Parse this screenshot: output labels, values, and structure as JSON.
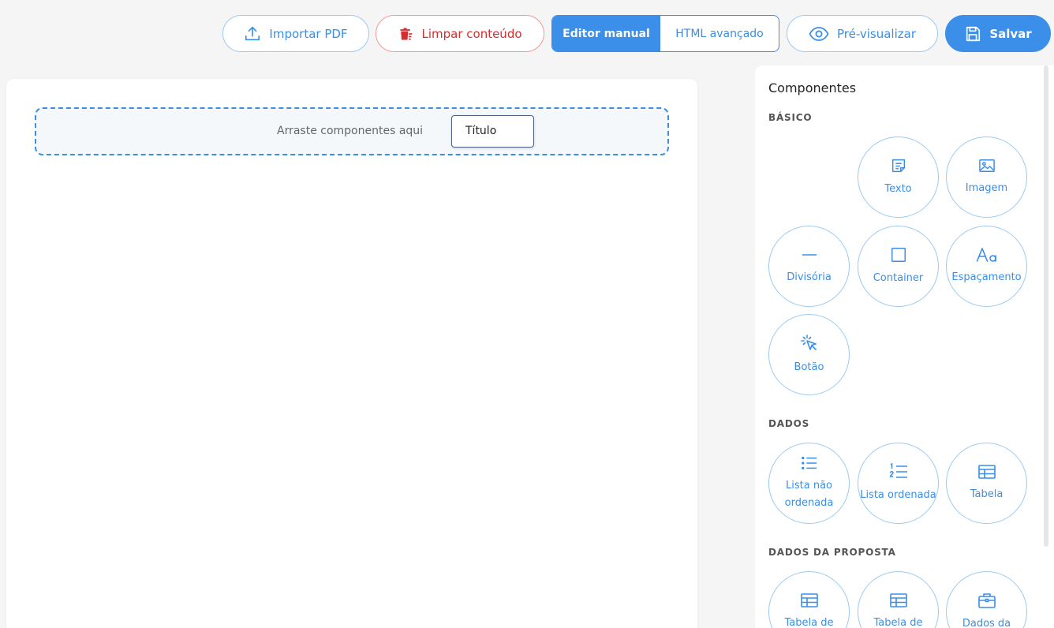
{
  "toolbar": {
    "import_label": "Importar PDF",
    "clear_label": "Limpar conteúdo",
    "mode_manual_label": "Editor manual",
    "mode_html_label": "HTML avançado",
    "preview_label": "Pré-visualizar",
    "save_label": "Salvar",
    "active_mode": "Editor manual"
  },
  "canvas": {
    "drop_hint": "Arraste componentes aqui",
    "dragging_chip": "Título"
  },
  "panel": {
    "title": "Componentes",
    "sections": [
      {
        "label": "BÁSICO",
        "items": [
          {
            "label": "Texto",
            "icon": "text-icon"
          },
          {
            "label": "Imagem",
            "icon": "image-icon"
          },
          {
            "label": "Divisória",
            "icon": "divider-icon"
          },
          {
            "label": "Container",
            "icon": "container-icon"
          },
          {
            "label": "Espaçamento",
            "icon": "typography-icon"
          },
          {
            "label": "Botão",
            "icon": "cursor-click-icon"
          }
        ]
      },
      {
        "label": "DADOS",
        "items": [
          {
            "label": "Lista não ordenada",
            "icon": "unordered-list-icon"
          },
          {
            "label": "Lista ordenada",
            "icon": "ordered-list-icon"
          },
          {
            "label": "Tabela",
            "icon": "table-icon"
          }
        ]
      },
      {
        "label": "DADOS DA PROPOSTA",
        "items": [
          {
            "label": "Tabela de",
            "icon": "table-icon"
          },
          {
            "label": "Tabela de",
            "icon": "table-icon"
          },
          {
            "label": "Dados da",
            "icon": "briefcase-icon"
          }
        ]
      }
    ]
  },
  "colors": {
    "accent": "#3b8fe8",
    "danger": "#d32f2f",
    "background": "#f5f5f5",
    "dropzone_border": "#3d8ee0"
  }
}
